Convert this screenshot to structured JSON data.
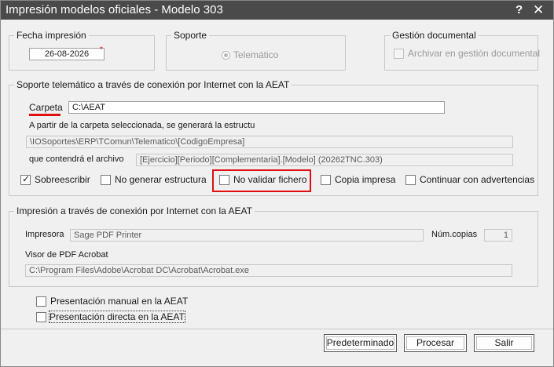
{
  "window": {
    "title": "Impresión modelos oficiales - Modelo 303",
    "help_glyph": "?",
    "close_glyph": "✕"
  },
  "fecha": {
    "legend": "Fecha impresión",
    "value": "26-08-2026",
    "required_mark": "*"
  },
  "soporte": {
    "legend": "Soporte",
    "option_label": "Telemático",
    "option_selected": true
  },
  "gestion": {
    "legend": "Gestión documental",
    "archivar_label": "Archivar en gestión documental",
    "archivar_checked": false
  },
  "telematico": {
    "legend": "Soporte telemático a través de conexión por Internet con la AEAT",
    "carpeta_label": "Carpeta",
    "carpeta_value": "C:\\AEAT",
    "estructura_label": "A partir de la carpeta seleccionada, se generará la estructu",
    "estructura_value": "\\IOSoportes\\ERP\\TComun\\Telematico\\[CodigoEmpresa]",
    "archivo_label": "que contendrá el archivo",
    "archivo_value": "[Ejercicio][Periodo][Complementaria].[Modelo] (20262TNC.303)",
    "options": [
      {
        "label": "Sobreescribir",
        "checked": true
      },
      {
        "label": "No generar estructura",
        "checked": false
      },
      {
        "label": "No validar fichero",
        "checked": false
      },
      {
        "label": "Copia impresa",
        "checked": false
      },
      {
        "label": "Continuar con advertencias",
        "checked": false
      }
    ]
  },
  "impresion": {
    "legend": "Impresión a través de conexión por Internet con la AEAT",
    "impresora_label": "Impresora",
    "impresora_value": "Sage PDF Printer",
    "copias_label": "Núm.copias",
    "copias_value": "1",
    "visor_label": "Visor de PDF Acrobat",
    "visor_value": "C:\\Program Files\\Adobe\\Acrobat DC\\Acrobat\\Acrobat.exe"
  },
  "presentacion": {
    "manual_label": "Presentación manual en la AEAT",
    "manual_checked": false,
    "directa_label": "Presentación directa en la AEAT",
    "directa_checked": false
  },
  "buttons": {
    "predeterminado": "Predeterminado",
    "procesar": "Procesar",
    "salir": "Salir"
  },
  "colors": {
    "titlebar": "#4a4a4a",
    "highlight": "#e01010"
  }
}
